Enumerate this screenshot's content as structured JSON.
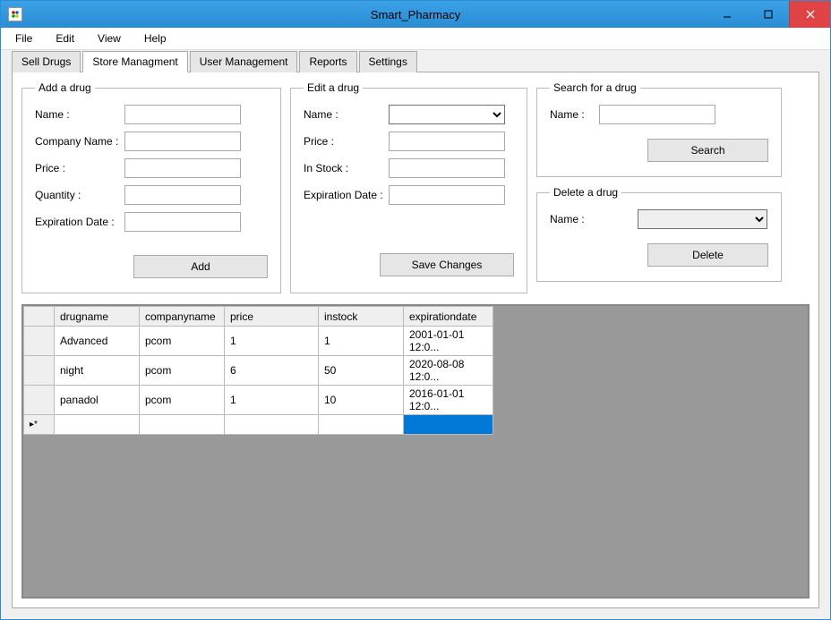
{
  "window": {
    "title": "Smart_Pharmacy"
  },
  "menu": {
    "file": "File",
    "edit": "Edit",
    "view": "View",
    "help": "Help"
  },
  "tabs": {
    "sell": "Sell Drugs",
    "store": "Store Managment",
    "user": "User Management",
    "reports": "Reports",
    "settings": "Settings"
  },
  "add": {
    "legend": "Add a drug",
    "name_label": "Name :",
    "company_label": "Company Name :",
    "price_label": "Price :",
    "quantity_label": "Quantity :",
    "exp_label": "Expiration Date :",
    "button": "Add"
  },
  "editg": {
    "legend": "Edit a drug",
    "name_label": "Name :",
    "price_label": "Price :",
    "stock_label": "In Stock :",
    "exp_label": "Expiration Date :",
    "button": "Save Changes"
  },
  "search": {
    "legend": "Search for a drug",
    "name_label": "Name :",
    "button": "Search"
  },
  "del": {
    "legend": "Delete a drug",
    "name_label": "Name :",
    "button": "Delete"
  },
  "grid": {
    "headers": {
      "drugname": "drugname",
      "companyname": "companyname",
      "price": "price",
      "instock": "instock",
      "expirationdate": "expirationdate"
    },
    "rows": [
      {
        "drugname": "Advanced",
        "companyname": "pcom",
        "price": "1",
        "instock": "1",
        "expirationdate": "2001-01-01 12:0..."
      },
      {
        "drugname": "night",
        "companyname": "pcom",
        "price": "6",
        "instock": "50",
        "expirationdate": "2020-08-08 12:0..."
      },
      {
        "drugname": "panadol",
        "companyname": "pcom",
        "price": "1",
        "instock": "10",
        "expirationdate": "2016-01-01 12:0..."
      }
    ],
    "newrow_marker": "▸*"
  }
}
